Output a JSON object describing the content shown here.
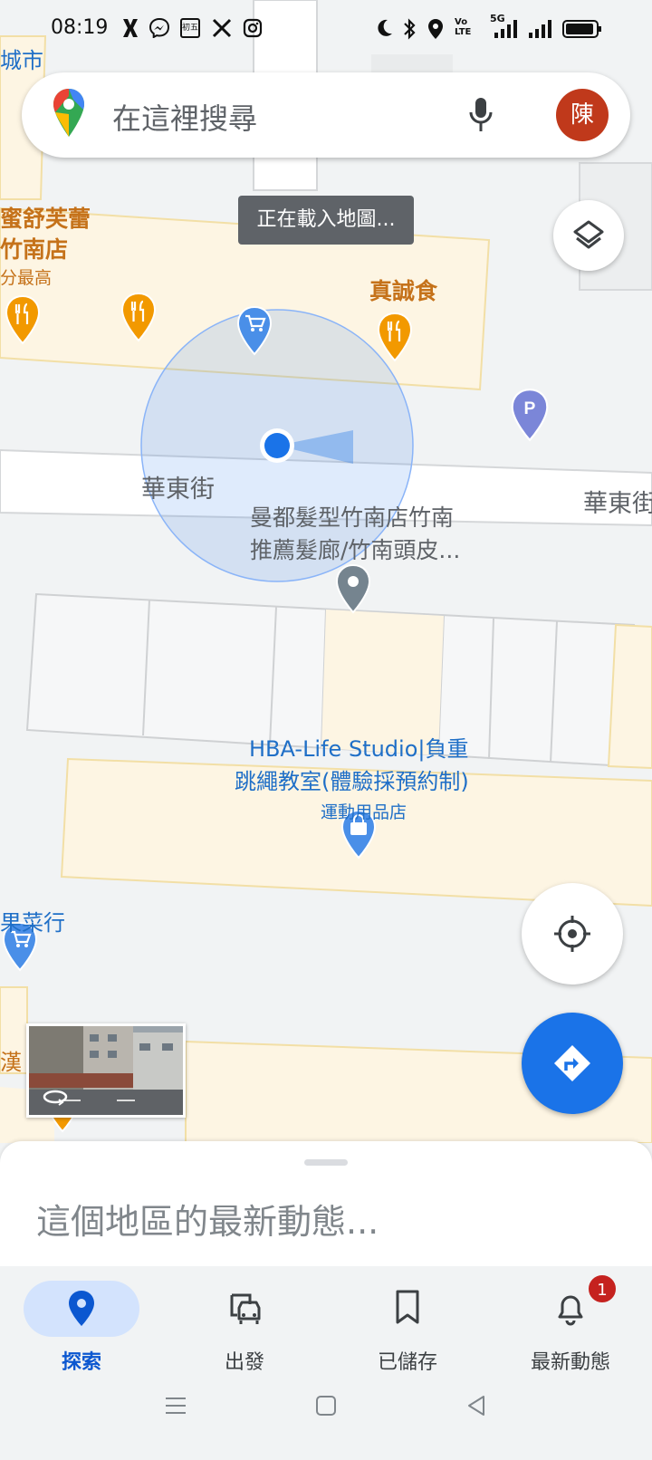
{
  "status_bar": {
    "time": "08:19",
    "day_badge": "初五",
    "network_label": "5G",
    "volte_label": "Vo LTE",
    "left_icons": [
      "x-messenger-icon",
      "messenger-icon",
      "calendar-icon",
      "x-icon",
      "instagram-icon"
    ],
    "right_icons": [
      "moon-icon",
      "bluetooth-icon",
      "location-icon",
      "signal-icon",
      "battery-icon"
    ]
  },
  "search": {
    "placeholder": "在這裡搜尋",
    "avatar_letter": "陳",
    "avatar_color": "#c0391b"
  },
  "toast": "正在載入地圖...",
  "map": {
    "labels": {
      "city_fragment": "城市",
      "dessert_line1": "蜜舒芙蕾",
      "dessert_line2": "竹南店",
      "dessert_rating": "分最高",
      "zhen_cheng": "真誠食",
      "street_left": "華東街",
      "street_right": "華東街",
      "salon_line1": "曼都髮型竹南店竹南",
      "salon_line2": "推薦髮廊/竹南頭皮...",
      "studio_line1": "HBA-Life Studio|負重",
      "studio_line2": "跳繩教室(體驗採預約制)",
      "studio_category": "運動用品店",
      "grocer": "果菜行",
      "han_fragment": "漢"
    },
    "parking_letter": "P",
    "accent_color": "#1a73e8"
  },
  "bottom_sheet": {
    "title": "這個地區的最新動態..."
  },
  "bottom_nav": {
    "items": [
      {
        "label": "探索",
        "icon": "explore-pin-icon",
        "active": true
      },
      {
        "label": "出發",
        "icon": "commute-car-icon",
        "active": false
      },
      {
        "label": "已儲存",
        "icon": "bookmark-icon",
        "active": false
      },
      {
        "label": "最新動態",
        "icon": "bell-icon",
        "active": false,
        "badge": "1"
      }
    ]
  }
}
